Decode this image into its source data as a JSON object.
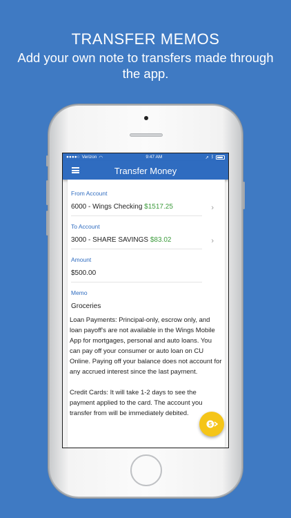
{
  "promo": {
    "headline": "TRANSFER MEMOS",
    "subline": "Add your own note to transfers made through the app."
  },
  "statusbar": {
    "carrier": "Verizon",
    "time": "9:47 AM"
  },
  "appbar": {
    "title": "Transfer Money",
    "menu_icon": "hamburger-menu-icon"
  },
  "form": {
    "from_account": {
      "label": "From Account",
      "account": "6000 - Wings Checking ",
      "balance": "$1517.25"
    },
    "to_account": {
      "label": "To Account",
      "account": "3000 - SHARE SAVINGS ",
      "balance": "$83.02"
    },
    "amount": {
      "label": "Amount",
      "value": "$500.00"
    },
    "memo": {
      "label": "Memo",
      "value": "Groceries"
    }
  },
  "disclaimer": {
    "loan": "Loan Payments: Principal-only, escrow only, and loan payoff's are not available in the Wings Mobile App for mortgages, personal and auto loans. You can pay off your consumer or auto loan on CU Online. Paying off your balance does not account for any accrued interest since the last payment.",
    "credit": "Credit Cards: It will take 1-2 days to see the payment applied to the card. The account you transfer from will be immediately debited."
  },
  "fab": {
    "icon": "transfer-coins-icon"
  },
  "colors": {
    "background": "#3f7ac3",
    "appbar": "#2f6cc0",
    "balance_green": "#3c9b3c",
    "fab_yellow": "#f5c518"
  }
}
